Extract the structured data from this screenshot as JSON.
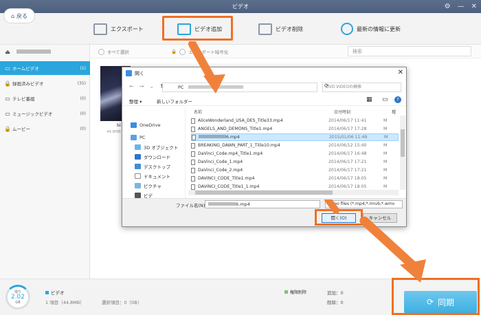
{
  "window": {
    "title": "ビデオ"
  },
  "toolbar": {
    "back_label": "戻る",
    "export_label": "エクスポート",
    "add_video_label": "ビデオ追加",
    "delete_video_label": "ビデオ削除",
    "refresh_label": "最新の情報に更新"
  },
  "main_header": {
    "select_all_label": "すべて選択",
    "export_encryption_label": "エクスポート暗号化",
    "search_placeholder": "検索"
  },
  "sidebar": {
    "items": [
      {
        "label": "ホームビデオ",
        "count": "(1)"
      },
      {
        "label": "録画済みビデオ",
        "count": "(35)"
      },
      {
        "label": "テレビ番組",
        "count": "(0)"
      },
      {
        "label": "ミュージックビデオ",
        "count": "(0)"
      },
      {
        "label": "ムービー",
        "count": "(0)"
      }
    ]
  },
  "thumbnail": {
    "caption": "bi",
    "size": "44.8MB"
  },
  "dialog": {
    "title": "開く",
    "path_pc": "PC",
    "search_placeholder": "DVD VIDEOの検索",
    "organize_label": "整理 ▾",
    "new_folder_label": "新しいフォルダー",
    "col_name": "名前",
    "col_date": "日付時刻",
    "col_type": "種",
    "tree": [
      "OneDrive",
      "PC",
      "3D オブジェクト",
      "ダウンロード",
      "デスクトップ",
      "ドキュメント",
      "ピクチャ",
      "ビデ"
    ],
    "files": [
      {
        "name": "AliceWonderland_USA_DES_Title33.mp4",
        "date": "2014/06/17 11:41",
        "ext": "M"
      },
      {
        "name": "ANGELS_AND_DEMONS_Title1.mp4",
        "date": "2014/06/17 17:28",
        "ext": "M"
      },
      {
        "name": "6.mp4",
        "date": "2015/01/06 11:49",
        "ext": "M"
      },
      {
        "name": "BREAKING_DAWN_PART_1_Title10.mp4",
        "date": "2014/06/12 15:40",
        "ext": "M"
      },
      {
        "name": "DaVinci_Code.mp4_Title1.mp4",
        "date": "2014/06/17 16:48",
        "ext": "M"
      },
      {
        "name": "DaVinci_Code_1.mp4",
        "date": "2014/06/17 17:21",
        "ext": "M"
      },
      {
        "name": "DaVinci_Code_2.mp4",
        "date": "2014/06/17 17:21",
        "ext": "M"
      },
      {
        "name": "DAVINCI_CODE_Title1.mp4",
        "date": "2014/06/17 18:05",
        "ext": "M"
      },
      {
        "name": "DAVINCI_CODE_Title1_1.mp4",
        "date": "2014/06/17 18:05",
        "ext": "M"
      }
    ],
    "filename_label": "ファイル名(N):",
    "filename_value": "6.mp4",
    "filetype_value": "Video files (*.mp4;*.rmvb;*.wmv",
    "open_label": "開く(O)",
    "cancel_label": "キャンセル"
  },
  "status": {
    "storage_label": "残り",
    "storage_value": "2.02",
    "storage_unit": "GB",
    "video_label": "ビデオ",
    "items_label": "1 項目（44.8MB）",
    "selected_label": "選択項目：0（0B）",
    "pending_delete_label": "権限削除",
    "add_label": "追加：0",
    "delete_label": "削除：0"
  },
  "sync_label": "同期",
  "colors": {
    "accent": "#2aa6dd",
    "highlight": "#ef6f24"
  }
}
